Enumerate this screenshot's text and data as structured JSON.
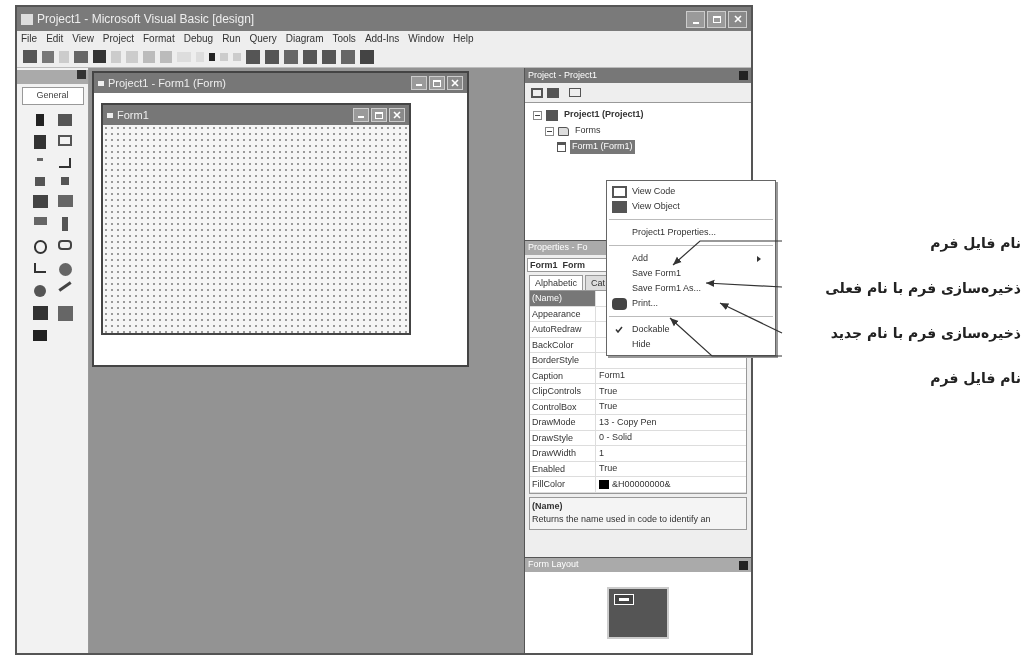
{
  "window": {
    "title": "Project1 - Microsoft Visual Basic [design]"
  },
  "menu": [
    "File",
    "Edit",
    "View",
    "Project",
    "Format",
    "Debug",
    "Run",
    "Query",
    "Diagram",
    "Tools",
    "Add-Ins",
    "Window",
    "Help"
  ],
  "toolbox": {
    "tab": "General"
  },
  "designer": {
    "title": "Project1 - Form1 (Form)",
    "form_title": "Form1"
  },
  "project_explorer": {
    "title": "Project - Project1",
    "tree": [
      {
        "label": "Project1 (Project1)",
        "kind": "project",
        "expanded": true,
        "selected": false,
        "children": [
          {
            "label": "Forms",
            "kind": "folder",
            "expanded": true,
            "selected": false,
            "children": [
              {
                "label": "Form1 (Form1)",
                "kind": "form",
                "selected": true
              }
            ]
          }
        ]
      }
    ]
  },
  "context_menu": [
    {
      "kind": "viewcode",
      "label": "View Code",
      "checked": false
    },
    {
      "kind": "viewobject",
      "label": "View Object",
      "checked": false
    },
    {
      "kind": "separator"
    },
    {
      "kind": "item",
      "label": "Project1 Properties...",
      "checked": false
    },
    {
      "kind": "separator"
    },
    {
      "kind": "submenu",
      "label": "Add",
      "checked": false
    },
    {
      "kind": "item",
      "label": "Save Form1",
      "checked": false
    },
    {
      "kind": "item",
      "label": "Save Form1 As...",
      "checked": false
    },
    {
      "kind": "print",
      "label": "Print...",
      "checked": false
    },
    {
      "kind": "separator"
    },
    {
      "kind": "item",
      "label": "Dockable",
      "checked": true
    },
    {
      "kind": "item",
      "label": "Hide",
      "checked": false
    }
  ],
  "properties": {
    "title": "Properties - Fo",
    "object": "Form1  Form",
    "tabs": [
      {
        "label": "Alphabetic",
        "selected": true
      },
      {
        "label": "Cat",
        "selected": false
      }
    ],
    "rows": [
      {
        "name": "(Name)",
        "selected": true
      },
      {
        "name": "Appearance",
        "selected": false
      },
      {
        "name": "AutoRedraw",
        "selected": false
      },
      {
        "name": "BackColor",
        "selected": false
      },
      {
        "name": "BorderStyle",
        "selected": false
      },
      {
        "name": "Caption",
        "value": "Form1",
        "selected": false
      },
      {
        "name": "ClipControls",
        "value": "True",
        "selected": false
      },
      {
        "name": "ControlBox",
        "value": "True",
        "selected": false
      },
      {
        "name": "DrawMode",
        "value": "13 - Copy Pen",
        "selected": false
      },
      {
        "name": "DrawStyle",
        "value": "0 - Solid",
        "selected": false
      },
      {
        "name": "DrawWidth",
        "value": "1",
        "selected": false
      },
      {
        "name": "Enabled",
        "value": "True",
        "selected": false
      },
      {
        "name": "FillColor",
        "value": "&H00000000&",
        "kind": "color",
        "selected": false
      }
    ],
    "description_title": "(Name)",
    "description": "Returns the name used in code to identify an"
  },
  "form_layout": {
    "title": "Form Layout"
  },
  "annotations": [
    "نام فایل فرم",
    "ذخیره‌سازی فرم با نام فعلی",
    "ذخیره‌سازی فرم با نام جدید",
    "نام فایل فرم"
  ]
}
